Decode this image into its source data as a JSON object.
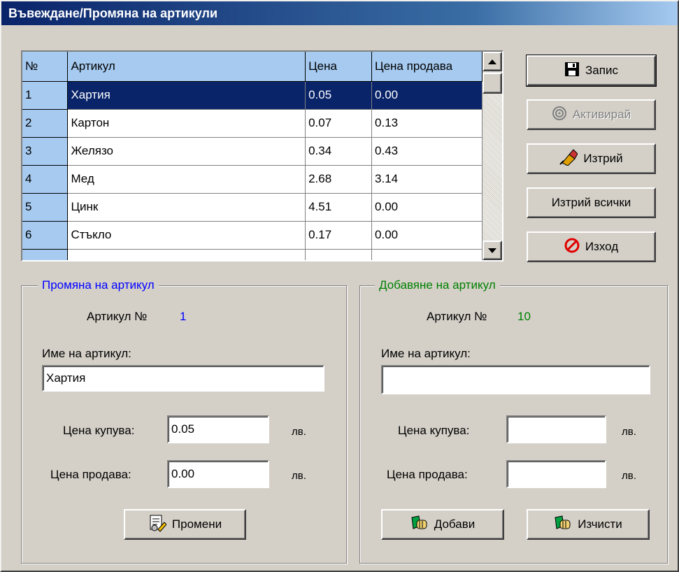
{
  "window": {
    "title": "Въвеждане/Промяна на артикули"
  },
  "grid": {
    "columns": [
      "№",
      "Артикул",
      "Цена",
      "Цена продава"
    ],
    "rows": [
      {
        "num": "1",
        "name": "Хартия",
        "price": "0.05",
        "sell": "0.00"
      },
      {
        "num": "2",
        "name": "Картон",
        "price": "0.07",
        "sell": "0.13"
      },
      {
        "num": "3",
        "name": "Желязо",
        "price": "0.34",
        "sell": "0.43"
      },
      {
        "num": "4",
        "name": "Мед",
        "price": "2.68",
        "sell": "3.14"
      },
      {
        "num": "5",
        "name": "Цинк",
        "price": "4.51",
        "sell": "0.00"
      },
      {
        "num": "6",
        "name": "Стъкло",
        "price": "0.17",
        "sell": "0.00"
      }
    ],
    "selected_row": 1
  },
  "buttons": {
    "save": "Запис",
    "activate": "Активирай",
    "delete": "Изтрий",
    "delete_all": "Изтрий всички",
    "exit": "Изход"
  },
  "edit_group": {
    "legend": "Промяна на артикул",
    "article_no_label": "Артикул №",
    "article_no": "1",
    "name_label": "Име на артикул:",
    "name_value": "Хартия",
    "buy_label": "Цена купува:",
    "buy_value": "0.05",
    "sell_label": "Цена продава:",
    "sell_value": "0.00",
    "currency": "лв.",
    "change_button": "Промени",
    "color": "#0000ff"
  },
  "add_group": {
    "legend": "Добавяне на артикул",
    "article_no_label": "Артикул №",
    "article_no": "10",
    "name_label": "Име на артикул:",
    "name_value": "",
    "buy_label": "Цена купува:",
    "buy_value": "",
    "sell_label": "Цена продава:",
    "sell_value": "",
    "currency": "лв.",
    "add_button": "Добави",
    "clear_button": "Изчисти",
    "color": "#008000"
  }
}
